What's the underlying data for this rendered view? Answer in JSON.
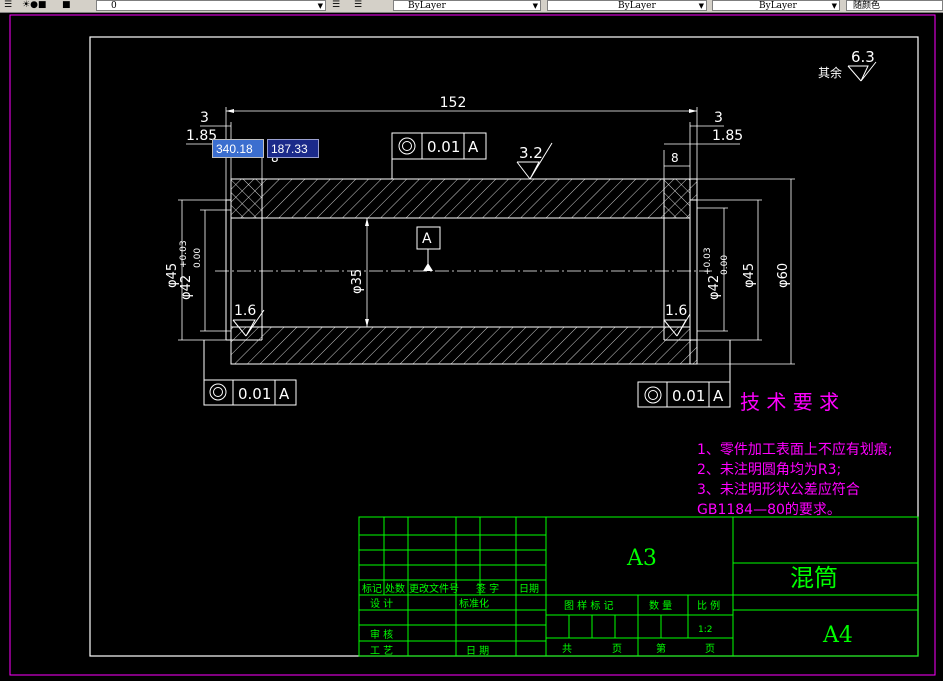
{
  "toolbar": {
    "layer_name": "0",
    "color_value": "ByLayer",
    "linetype_value": "ByLayer",
    "lineweight_value": "ByLayer",
    "plotstyle_value": "随颜色"
  },
  "drawing": {
    "roughness_note": "其余",
    "roughness_general": "6.3",
    "dim_overall_length": "152",
    "dim_left_groove_width": "3",
    "dim_left_groove_depth": "1.85",
    "dim_right_groove_width": "3",
    "dim_right_groove_depth": "1.85",
    "dim_right_step": "8",
    "dim_left_step_partial": "8",
    "gtol_top_value": "0.01",
    "gtol_top_datum": "A",
    "gtol_left_value": "0.01",
    "gtol_left_datum": "A",
    "gtol_right_value": "0.01",
    "gtol_right_datum": "A",
    "datum_label": "A",
    "roughness_outer": "3.2",
    "roughness_left_inner": "1.6",
    "roughness_right_inner": "1.6",
    "dia_left_45": "φ45",
    "dia_left_42": "φ42",
    "tol_left_upper": "+0.03",
    "tol_left_lower": "0.00",
    "dia_bore": "φ35",
    "dia_right_42": "φ42",
    "tol_right_upper": "+0.03",
    "tol_right_lower": "0.00",
    "dia_right_45": "φ45",
    "dia_outer": "φ60"
  },
  "notes": {
    "title": "技 术 要 求",
    "lines": [
      "1、零件加工表面上不应有划痕;",
      "2、未注明圆角均为R3;",
      "3、未注明形状公差应符合",
      "GB1184—80的要求。"
    ]
  },
  "title_block": {
    "sheet_size": "A3",
    "part_name": "混筒",
    "drawing_no": "A4",
    "rev_headers": [
      "标记",
      "处数",
      "更改文件号",
      "签 字",
      "日期"
    ],
    "row_design": "设 计",
    "row_standard": "标准化",
    "row_review": "审 核",
    "row_process": "工 艺",
    "row_date": "日 期",
    "col_stage_mark": "图 样 标 记",
    "col_weight": "数 量",
    "col_scale": "比 例",
    "scale_value": "1:2",
    "total_label": "共",
    "sheet_label": "页",
    "page_label": "第",
    "page_label2": "页"
  },
  "dynamic_input": {
    "x_value": "340.18",
    "y_value": "187.33"
  },
  "colors": {
    "frame": "#ffffff",
    "border": "#ff00ff",
    "title_block": "#00ff00",
    "notes": "#ff00ff",
    "hatch": "#ffffff",
    "centerline": "#ffffff"
  }
}
